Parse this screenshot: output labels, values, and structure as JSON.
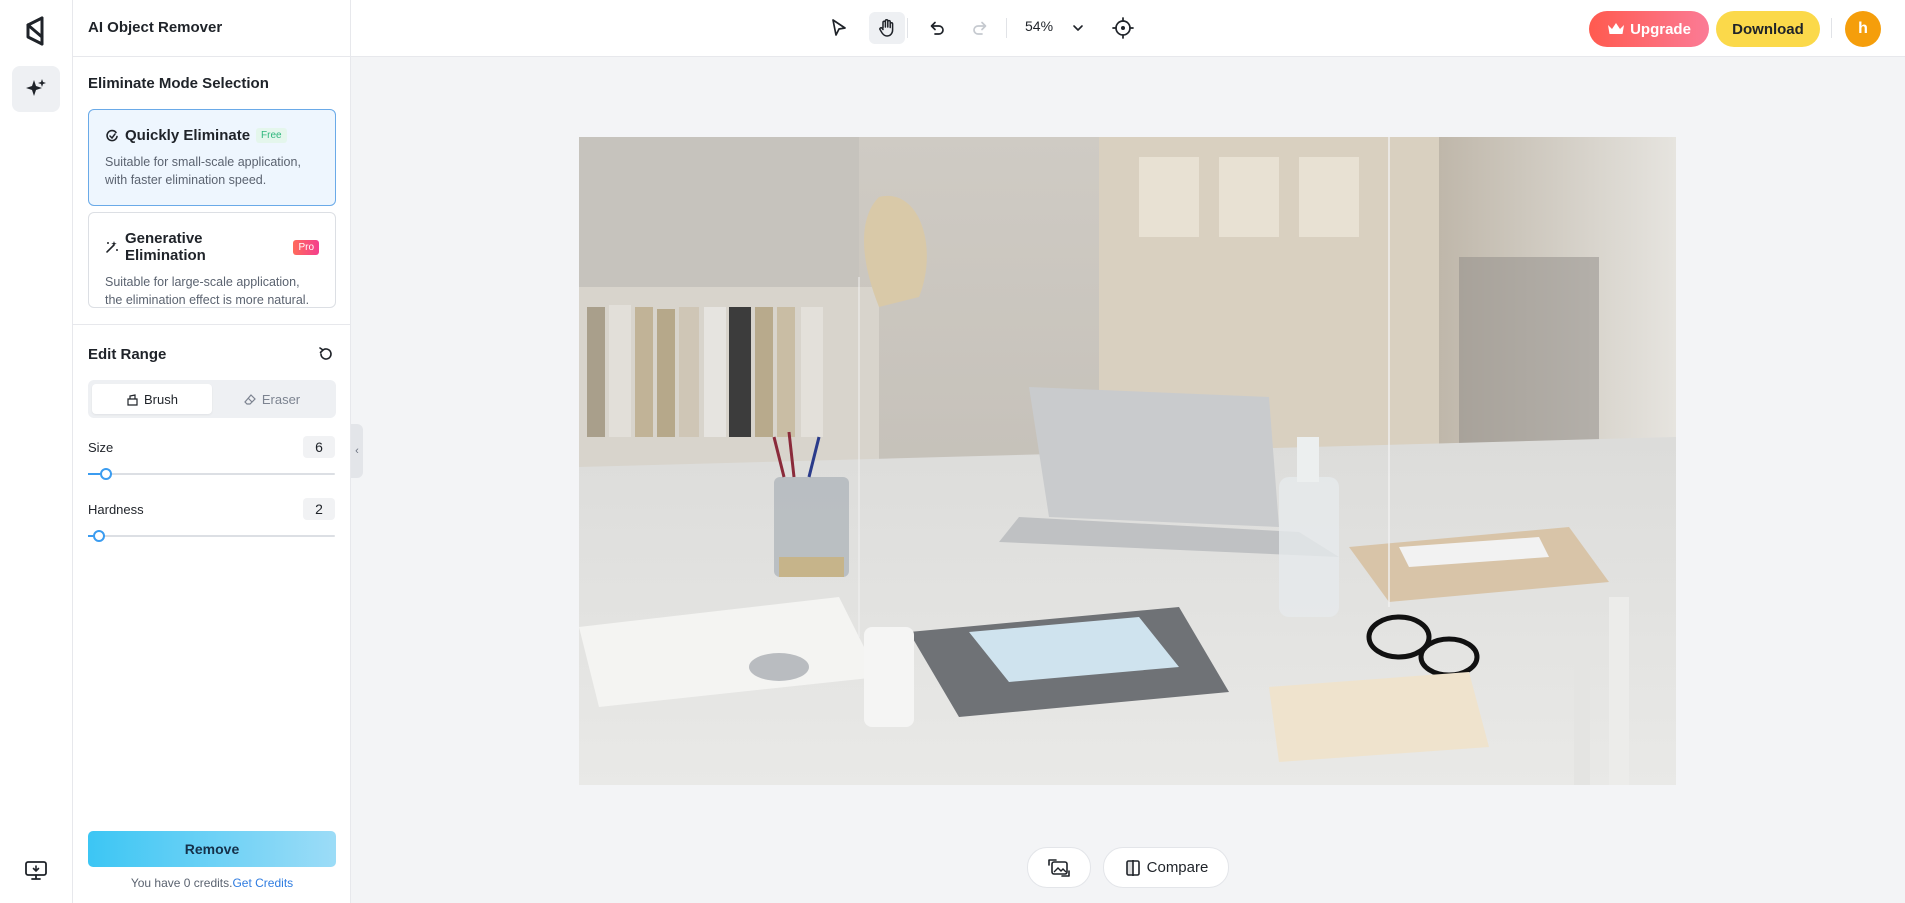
{
  "app": {
    "title": "AI Object Remover"
  },
  "modes": {
    "section_title": "Eliminate Mode Selection",
    "items": [
      {
        "title": "Quickly Eliminate",
        "badge": "Free",
        "desc_line1": "Suitable for small-scale application,",
        "desc_line2": "with faster elimination speed.",
        "selected": true
      },
      {
        "title": "Generative Elimination",
        "badge": "Pro",
        "desc_line1": "Suitable for large-scale application,",
        "desc_line2": "the elimination effect is more natural.",
        "selected": false
      }
    ]
  },
  "edit": {
    "section_title": "Edit Range",
    "tools": [
      {
        "label": "Brush",
        "active": true
      },
      {
        "label": "Eraser",
        "active": false
      }
    ],
    "size": {
      "label": "Size",
      "value": "6",
      "fraction": 0.05
    },
    "hardness": {
      "label": "Hardness",
      "value": "2",
      "fraction": 0.02
    }
  },
  "actions": {
    "remove_label": "Remove",
    "credits_text": "You have 0 credits.",
    "credits_link": "Get Credits"
  },
  "toolbar": {
    "zoom": "54%",
    "upgrade_label": "Upgrade",
    "download_label": "Download",
    "avatar_initial": "h"
  },
  "bottom": {
    "compare_label": "Compare"
  },
  "colors": {
    "accent_blue": "#3b9cf0",
    "upgrade": "#ff5a4f",
    "download": "#fbd94a",
    "avatar": "#f59e0b"
  },
  "icons": [
    "app-logo-icon",
    "magic-sparkle-icon",
    "screen-icon",
    "select-pointer-icon",
    "hand-pan-icon",
    "undo-icon",
    "redo-icon",
    "chevron-down-icon",
    "target-center-icon",
    "crown-icon",
    "eraser-quick-icon",
    "wand-icon",
    "reset-icon",
    "brush-icon",
    "eraser-icon",
    "image-swap-icon",
    "compare-icon"
  ]
}
